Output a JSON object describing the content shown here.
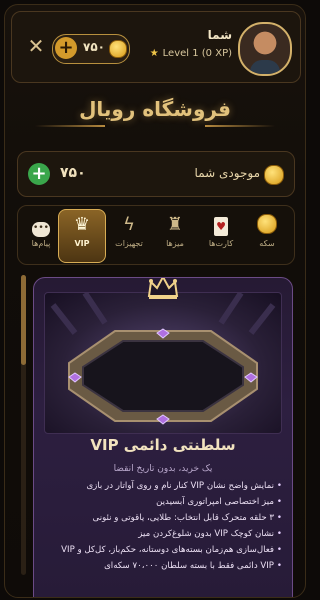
{
  "header": {
    "close_icon": "close-icon",
    "coin_balance": "۷۵۰",
    "user_name": "شما",
    "level_text": "Level 1 (0 XP)"
  },
  "store": {
    "title": "فروشگاه رویال"
  },
  "balance": {
    "value": "۷۵۰",
    "label": "موجودی شما"
  },
  "tabs": [
    {
      "label": "سکه",
      "icon": "coin-icon"
    },
    {
      "label": "کارت‌ها",
      "icon": "cards-icon"
    },
    {
      "label": "میزها",
      "icon": "table-icon"
    },
    {
      "label": "تجهیزات",
      "icon": "lightning-icon"
    },
    {
      "label": "VIP",
      "icon": "crown-icon",
      "active": true
    },
    {
      "label": "پیام‌ها",
      "icon": "chat-icon"
    }
  ],
  "product": {
    "title": "VIP سلطنتی دائمی",
    "subtitle": "یک خرید، بدون تاریخ انقضا",
    "features": [
      "نمایش واضح نشان VIP کنار نام و روی آواتار در بازی",
      "میز اختصاصی امپراتوری آبسیدین",
      "۳ حلقه متحرک قابل انتخاب: طلایی، یاقوتی و نئونی",
      "نشان کوچک VIP بدون شلوغ‌کردن میز",
      "فعال‌سازی هم‌زمان بسته‌های دوستانه، حکم‌باز، کل‌کل و VIP",
      "VIP دائمی فقط با بسته سلطان ۷۰،۰۰۰ سکه‌ای"
    ]
  },
  "colors": {
    "accent_gold": "#d8ad55",
    "card_purple": "#2d1f40",
    "plus_green": "#3aa64b"
  }
}
